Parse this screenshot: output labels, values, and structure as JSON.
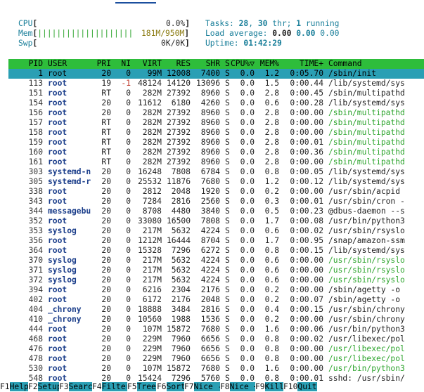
{
  "meters": {
    "cpu": {
      "label": "CPU",
      "value": "0.0%"
    },
    "mem": {
      "label": "Mem",
      "bars": "||||||||||||||||||||",
      "value": "181M/950M"
    },
    "swp": {
      "label": "Swp",
      "value": "0K/0K"
    }
  },
  "stats": {
    "tasks_label": "Tasks: ",
    "tasks": "28",
    "thr": "30",
    "running": "1",
    "load_label": "Load average: ",
    "load1": "0.00",
    "load5": "0.00",
    "load15": "0.00",
    "uptime_label": "Uptime: ",
    "uptime": "01:42:29"
  },
  "columns": [
    "PID",
    "USER",
    "PRI",
    "NI",
    "VIRT",
    "RES",
    "SHR",
    "S",
    "CPU%▽",
    "MEM%",
    "TIME+",
    "Command"
  ],
  "processes": [
    {
      "pid": "1",
      "user": "root",
      "pri": "20",
      "ni": "0",
      "virt": "99M",
      "res": "12008",
      "shr": "7400",
      "s": "S",
      "cpu": "0.0",
      "mem": "1.2",
      "time": "0:05.70",
      "cmd": "/sbin/init",
      "thread": false,
      "selected": true
    },
    {
      "pid": "113",
      "user": "root",
      "pri": "19",
      "ni": "-1",
      "virt": "48124",
      "res": "14120",
      "shr": "13096",
      "s": "S",
      "cpu": "0.0",
      "mem": "1.5",
      "time": "0:00.44",
      "cmd": "/lib/systemd/sys",
      "thread": false
    },
    {
      "pid": "151",
      "user": "root",
      "pri": "RT",
      "ni": "0",
      "virt": "282M",
      "res": "27392",
      "shr": "8960",
      "s": "S",
      "cpu": "0.0",
      "mem": "2.8",
      "time": "0:00.45",
      "cmd": "/sbin/multipathd",
      "thread": false
    },
    {
      "pid": "154",
      "user": "root",
      "pri": "20",
      "ni": "0",
      "virt": "11612",
      "res": "6180",
      "shr": "4260",
      "s": "S",
      "cpu": "0.0",
      "mem": "0.6",
      "time": "0:00.28",
      "cmd": "/lib/systemd/sys",
      "thread": false
    },
    {
      "pid": "156",
      "user": "root",
      "pri": "20",
      "ni": "0",
      "virt": "282M",
      "res": "27392",
      "shr": "8960",
      "s": "S",
      "cpu": "0.0",
      "mem": "2.8",
      "time": "0:00.00",
      "cmd": "/sbin/multipathd",
      "thread": true
    },
    {
      "pid": "157",
      "user": "root",
      "pri": "RT",
      "ni": "0",
      "virt": "282M",
      "res": "27392",
      "shr": "8960",
      "s": "S",
      "cpu": "0.0",
      "mem": "2.8",
      "time": "0:00.00",
      "cmd": "/sbin/multipathd",
      "thread": true
    },
    {
      "pid": "158",
      "user": "root",
      "pri": "RT",
      "ni": "0",
      "virt": "282M",
      "res": "27392",
      "shr": "8960",
      "s": "S",
      "cpu": "0.0",
      "mem": "2.8",
      "time": "0:00.00",
      "cmd": "/sbin/multipathd",
      "thread": true
    },
    {
      "pid": "159",
      "user": "root",
      "pri": "RT",
      "ni": "0",
      "virt": "282M",
      "res": "27392",
      "shr": "8960",
      "s": "S",
      "cpu": "0.0",
      "mem": "2.8",
      "time": "0:00.01",
      "cmd": "/sbin/multipathd",
      "thread": true
    },
    {
      "pid": "160",
      "user": "root",
      "pri": "RT",
      "ni": "0",
      "virt": "282M",
      "res": "27392",
      "shr": "8960",
      "s": "S",
      "cpu": "0.0",
      "mem": "2.8",
      "time": "0:00.36",
      "cmd": "/sbin/multipathd",
      "thread": true
    },
    {
      "pid": "161",
      "user": "root",
      "pri": "RT",
      "ni": "0",
      "virt": "282M",
      "res": "27392",
      "shr": "8960",
      "s": "S",
      "cpu": "0.0",
      "mem": "2.8",
      "time": "0:00.00",
      "cmd": "/sbin/multipathd",
      "thread": true
    },
    {
      "pid": "303",
      "user": "systemd-n",
      "pri": "20",
      "ni": "0",
      "virt": "16248",
      "res": "7808",
      "shr": "6784",
      "s": "S",
      "cpu": "0.0",
      "mem": "0.8",
      "time": "0:00.05",
      "cmd": "/lib/systemd/sys",
      "thread": false
    },
    {
      "pid": "305",
      "user": "systemd-r",
      "pri": "20",
      "ni": "0",
      "virt": "25532",
      "res": "11876",
      "shr": "7680",
      "s": "S",
      "cpu": "0.0",
      "mem": "1.2",
      "time": "0:00.12",
      "cmd": "/lib/systemd/sys",
      "thread": false
    },
    {
      "pid": "338",
      "user": "root",
      "pri": "20",
      "ni": "0",
      "virt": "2812",
      "res": "2048",
      "shr": "1920",
      "s": "S",
      "cpu": "0.0",
      "mem": "0.2",
      "time": "0:00.00",
      "cmd": "/usr/sbin/acpid",
      "thread": false
    },
    {
      "pid": "343",
      "user": "root",
      "pri": "20",
      "ni": "0",
      "virt": "7284",
      "res": "2816",
      "shr": "2560",
      "s": "S",
      "cpu": "0.0",
      "mem": "0.3",
      "time": "0:00.01",
      "cmd": "/usr/sbin/cron -",
      "thread": false
    },
    {
      "pid": "344",
      "user": "messagebu",
      "pri": "20",
      "ni": "0",
      "virt": "8708",
      "res": "4480",
      "shr": "3840",
      "s": "S",
      "cpu": "0.0",
      "mem": "0.5",
      "time": "0:00.23",
      "cmd": "@dbus-daemon --s",
      "thread": false
    },
    {
      "pid": "352",
      "user": "root",
      "pri": "20",
      "ni": "0",
      "virt": "33080",
      "res": "16500",
      "shr": "7808",
      "s": "S",
      "cpu": "0.0",
      "mem": "1.7",
      "time": "0:00.08",
      "cmd": "/usr/bin/python3",
      "thread": false
    },
    {
      "pid": "353",
      "user": "syslog",
      "pri": "20",
      "ni": "0",
      "virt": "217M",
      "res": "5632",
      "shr": "4224",
      "s": "S",
      "cpu": "0.0",
      "mem": "0.6",
      "time": "0:00.02",
      "cmd": "/usr/sbin/rsyslo",
      "thread": false
    },
    {
      "pid": "356",
      "user": "root",
      "pri": "20",
      "ni": "0",
      "virt": "1212M",
      "res": "16444",
      "shr": "8704",
      "s": "S",
      "cpu": "0.0",
      "mem": "1.7",
      "time": "0:00.95",
      "cmd": "/snap/amazon-ssm",
      "thread": false
    },
    {
      "pid": "364",
      "user": "root",
      "pri": "20",
      "ni": "0",
      "virt": "15328",
      "res": "7296",
      "shr": "6272",
      "s": "S",
      "cpu": "0.0",
      "mem": "0.8",
      "time": "0:00.15",
      "cmd": "/lib/systemd/sys",
      "thread": false
    },
    {
      "pid": "370",
      "user": "syslog",
      "pri": "20",
      "ni": "0",
      "virt": "217M",
      "res": "5632",
      "shr": "4224",
      "s": "S",
      "cpu": "0.0",
      "mem": "0.6",
      "time": "0:00.00",
      "cmd": "/usr/sbin/rsyslo",
      "thread": true
    },
    {
      "pid": "371",
      "user": "syslog",
      "pri": "20",
      "ni": "0",
      "virt": "217M",
      "res": "5632",
      "shr": "4224",
      "s": "S",
      "cpu": "0.0",
      "mem": "0.6",
      "time": "0:00.00",
      "cmd": "/usr/sbin/rsyslo",
      "thread": true
    },
    {
      "pid": "372",
      "user": "syslog",
      "pri": "20",
      "ni": "0",
      "virt": "217M",
      "res": "5632",
      "shr": "4224",
      "s": "S",
      "cpu": "0.0",
      "mem": "0.6",
      "time": "0:00.00",
      "cmd": "/usr/sbin/rsyslo",
      "thread": true
    },
    {
      "pid": "394",
      "user": "root",
      "pri": "20",
      "ni": "0",
      "virt": "6216",
      "res": "2304",
      "shr": "2176",
      "s": "S",
      "cpu": "0.0",
      "mem": "0.2",
      "time": "0:00.00",
      "cmd": "/sbin/agetty -o",
      "thread": false
    },
    {
      "pid": "402",
      "user": "root",
      "pri": "20",
      "ni": "0",
      "virt": "6172",
      "res": "2176",
      "shr": "2048",
      "s": "S",
      "cpu": "0.0",
      "mem": "0.2",
      "time": "0:00.07",
      "cmd": "/sbin/agetty -o",
      "thread": false
    },
    {
      "pid": "404",
      "user": "_chrony",
      "pri": "20",
      "ni": "0",
      "virt": "18888",
      "res": "3484",
      "shr": "2816",
      "s": "S",
      "cpu": "0.0",
      "mem": "0.4",
      "time": "0:00.15",
      "cmd": "/usr/sbin/chrony",
      "thread": false
    },
    {
      "pid": "410",
      "user": "_chrony",
      "pri": "20",
      "ni": "0",
      "virt": "10560",
      "res": "1988",
      "shr": "1536",
      "s": "S",
      "cpu": "0.0",
      "mem": "0.2",
      "time": "0:00.00",
      "cmd": "/usr/sbin/chrony",
      "thread": false
    },
    {
      "pid": "444",
      "user": "root",
      "pri": "20",
      "ni": "0",
      "virt": "107M",
      "res": "15872",
      "shr": "7680",
      "s": "S",
      "cpu": "0.0",
      "mem": "1.6",
      "time": "0:00.06",
      "cmd": "/usr/bin/python3",
      "thread": false
    },
    {
      "pid": "468",
      "user": "root",
      "pri": "20",
      "ni": "0",
      "virt": "229M",
      "res": "7960",
      "shr": "6656",
      "s": "S",
      "cpu": "0.0",
      "mem": "0.8",
      "time": "0:00.02",
      "cmd": "/usr/libexec/pol",
      "thread": false
    },
    {
      "pid": "476",
      "user": "root",
      "pri": "20",
      "ni": "0",
      "virt": "229M",
      "res": "7960",
      "shr": "6656",
      "s": "S",
      "cpu": "0.0",
      "mem": "0.8",
      "time": "0:00.00",
      "cmd": "/usr/libexec/pol",
      "thread": true
    },
    {
      "pid": "478",
      "user": "root",
      "pri": "20",
      "ni": "0",
      "virt": "229M",
      "res": "7960",
      "shr": "6656",
      "s": "S",
      "cpu": "0.0",
      "mem": "0.8",
      "time": "0:00.00",
      "cmd": "/usr/libexec/pol",
      "thread": true
    },
    {
      "pid": "530",
      "user": "root",
      "pri": "20",
      "ni": "0",
      "virt": "107M",
      "res": "15872",
      "shr": "7680",
      "s": "S",
      "cpu": "0.0",
      "mem": "1.6",
      "time": "0:00.00",
      "cmd": "/usr/bin/python3",
      "thread": true
    },
    {
      "pid": "548",
      "user": "root",
      "pri": "20",
      "ni": "0",
      "virt": "15424",
      "res": "7296",
      "shr": "5760",
      "s": "S",
      "cpu": "0.0",
      "mem": "0.8",
      "time": "0:00.01",
      "cmd": "sshd: /usr/sbin/",
      "thread": false
    }
  ],
  "footer": [
    {
      "key": "F1",
      "label": "Help"
    },
    {
      "key": "F2",
      "label": "Setup"
    },
    {
      "key": "F3",
      "label": "Search"
    },
    {
      "key": "F4",
      "label": "Filter"
    },
    {
      "key": "F5",
      "label": "Tree"
    },
    {
      "key": "F6",
      "label": "SortBy"
    },
    {
      "key": "F7",
      "label": "Nice -"
    },
    {
      "key": "F8",
      "label": "Nice +"
    },
    {
      "key": "F9",
      "label": "Kill"
    },
    {
      "key": "F10",
      "label": "Quit"
    }
  ],
  "colors": {
    "header_bg": "#2ebd3b",
    "selected_bg": "#2a9fb4",
    "thread_text": "#2fa52f",
    "meter_label": "#1a7f9a",
    "negative_ni": "#c0392b"
  }
}
